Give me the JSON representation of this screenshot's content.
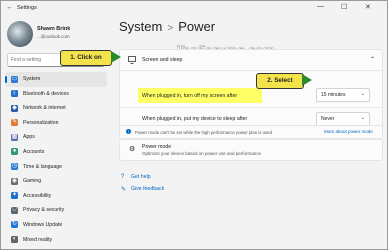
{
  "window": {
    "title": "Settings",
    "minimize": "—",
    "maximize": "☐",
    "close": "✕"
  },
  "profile": {
    "name": "Shawn Brink",
    "email": "...@outlook.com"
  },
  "search": {
    "placeholder": "Find a setting"
  },
  "nav": [
    {
      "label": "System",
      "icon": "system-icon",
      "color": "#2b7cd3",
      "active": true
    },
    {
      "label": "Bluetooth & devices",
      "icon": "bluetooth-icon",
      "color": "#1f6fd0"
    },
    {
      "label": "Network & internet",
      "icon": "wifi-icon",
      "color": "#2b5ea8"
    },
    {
      "label": "Personalization",
      "icon": "brush-icon",
      "color": "#e07b39"
    },
    {
      "label": "Apps",
      "icon": "apps-icon",
      "color": "#5a6fb0"
    },
    {
      "label": "Accounts",
      "icon": "accounts-icon",
      "color": "#2f9e6e"
    },
    {
      "label": "Time & language",
      "icon": "globe-clock-icon",
      "color": "#2b7cd3"
    },
    {
      "label": "Gaming",
      "icon": "gaming-icon",
      "color": "#6a6a6a"
    },
    {
      "label": "Accessibility",
      "icon": "accessibility-icon",
      "color": "#1a73c9"
    },
    {
      "label": "Privacy & security",
      "icon": "shield-icon",
      "color": "#5b6770"
    },
    {
      "label": "Windows Update",
      "icon": "update-icon",
      "color": "#1f7ad6"
    },
    {
      "label": "Mixed reality",
      "icon": "headset-icon",
      "color": "#5b6770"
    }
  ],
  "header": {
    "section": "System",
    "separator": ">",
    "page": "Power"
  },
  "watermark": "TenForums.com",
  "screen_sleep": {
    "title": "Screen and sleep",
    "plugged_screen_label": "When plugged in, turn off my screen after",
    "plugged_screen_value": "15 minutes",
    "plugged_sleep_label": "When plugged in, put my device to sleep after",
    "plugged_sleep_value": "Never"
  },
  "power_mode_info": {
    "text": "Power mode can't be set while the high performance power plan is used",
    "link": "More about power mode"
  },
  "power_mode": {
    "title": "Power mode",
    "description": "Optimize your device based on power use and performance"
  },
  "footer": {
    "help": "Get help",
    "feedback": "Give feedback"
  },
  "callouts": {
    "click_on": "1. Click on",
    "select": "2. Select"
  },
  "colors": {
    "accent": "#0067c0",
    "highlight": "#ffff66",
    "callout": "#f4e24a",
    "callout_arrow": "#2b8a2b"
  }
}
